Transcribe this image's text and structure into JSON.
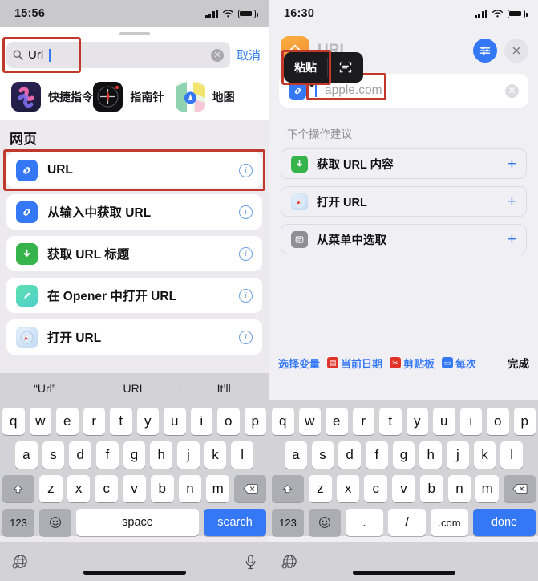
{
  "left_phone": {
    "status_bar": {
      "time": "15:56",
      "signal_icon": "cellular-bars-icon",
      "wifi_icon": "wifi-icon",
      "battery_icon": "battery-icon"
    },
    "search": {
      "icon": "search-icon",
      "value": "Url",
      "clear_icon": "clear-circle-icon",
      "cancel_label": "取消"
    },
    "apps": [
      {
        "name": "快捷指令",
        "icon": "shortcuts-app-icon"
      },
      {
        "name": "指南针",
        "icon": "compass-app-icon"
      },
      {
        "name": "地图",
        "icon": "maps-app-icon"
      }
    ],
    "section_title": "网页",
    "results": [
      {
        "label": "URL",
        "icon": "link-icon",
        "info_icon": "info-icon",
        "highlighted": true
      },
      {
        "label": "从输入中获取 URL",
        "icon": "link-icon",
        "info_icon": "info-icon"
      },
      {
        "label": "获取 URL 标题",
        "icon": "download-arrow-icon",
        "info_icon": "info-icon"
      },
      {
        "label": "在 Opener 中打开 URL",
        "icon": "opener-pen-icon",
        "info_icon": "info-icon"
      },
      {
        "label": "打开 URL",
        "icon": "safari-compass-icon",
        "info_icon": "info-icon"
      }
    ],
    "keyboard": {
      "predictions": [
        "“Url”",
        "URL",
        "It’ll"
      ],
      "row1": [
        "q",
        "w",
        "e",
        "r",
        "t",
        "y",
        "u",
        "i",
        "o",
        "p"
      ],
      "row2": [
        "a",
        "s",
        "d",
        "f",
        "g",
        "h",
        "j",
        "k",
        "l"
      ],
      "row3": [
        "z",
        "x",
        "c",
        "v",
        "b",
        "n",
        "m"
      ],
      "shift_icon": "shift-icon",
      "backspace_icon": "backspace-icon",
      "numbers_label": "123",
      "emoji_icon": "emoji-icon",
      "space_label": "space",
      "action_label": "search",
      "globe_icon": "globe-icon",
      "mic_icon": "microphone-icon"
    }
  },
  "right_phone": {
    "status_bar": {
      "time": "16:30",
      "signal_icon": "cellular-bars-icon",
      "wifi_icon": "wifi-icon",
      "battery_icon": "battery-icon"
    },
    "header": {
      "app_icon": "shortcut-action-icon",
      "title": "URL",
      "settings_icon": "sliders-icon",
      "close_icon": "close-icon"
    },
    "paste_popup": {
      "paste_label": "粘贴",
      "scan_icon": "scan-text-icon"
    },
    "url_field": {
      "icon": "link-icon",
      "placeholder": "apple.com",
      "clear_icon": "clear-circle-icon"
    },
    "suggestions_title": "下个操作建议",
    "suggestions": [
      {
        "label": "获取 URL 内容",
        "icon": "download-arrow-icon",
        "add_icon": "plus-icon"
      },
      {
        "label": "打开 URL",
        "icon": "safari-compass-icon",
        "add_icon": "plus-icon"
      },
      {
        "label": "从菜单中选取",
        "icon": "menu-select-icon",
        "add_icon": "plus-icon"
      }
    ],
    "variable_bar": {
      "select_variable": "选择变量",
      "current_date": "当前日期",
      "clipboard": "剪贴板",
      "every_time": "每次",
      "done": "完成",
      "date_icon": "calendar-icon",
      "clipboard_icon": "clipboard-icon",
      "ask_icon": "ask-each-time-icon"
    },
    "keyboard": {
      "row1": [
        "q",
        "w",
        "e",
        "r",
        "t",
        "y",
        "u",
        "i",
        "o",
        "p"
      ],
      "row2": [
        "a",
        "s",
        "d",
        "f",
        "g",
        "h",
        "j",
        "k",
        "l"
      ],
      "row3": [
        "z",
        "x",
        "c",
        "v",
        "b",
        "n",
        "m"
      ],
      "shift_icon": "shift-icon",
      "backspace_icon": "backspace-icon",
      "numbers_label": "123",
      "emoji_icon": "emoji-icon",
      "dot_label": ".",
      "slash_label": "/",
      "dotcom_label": ".com",
      "action_label": "done",
      "globe_icon": "globe-icon"
    }
  },
  "colors": {
    "highlight_red": "#c0392b",
    "ios_blue": "#3478f6",
    "green": "#34b44a",
    "orange": "#f29130"
  }
}
